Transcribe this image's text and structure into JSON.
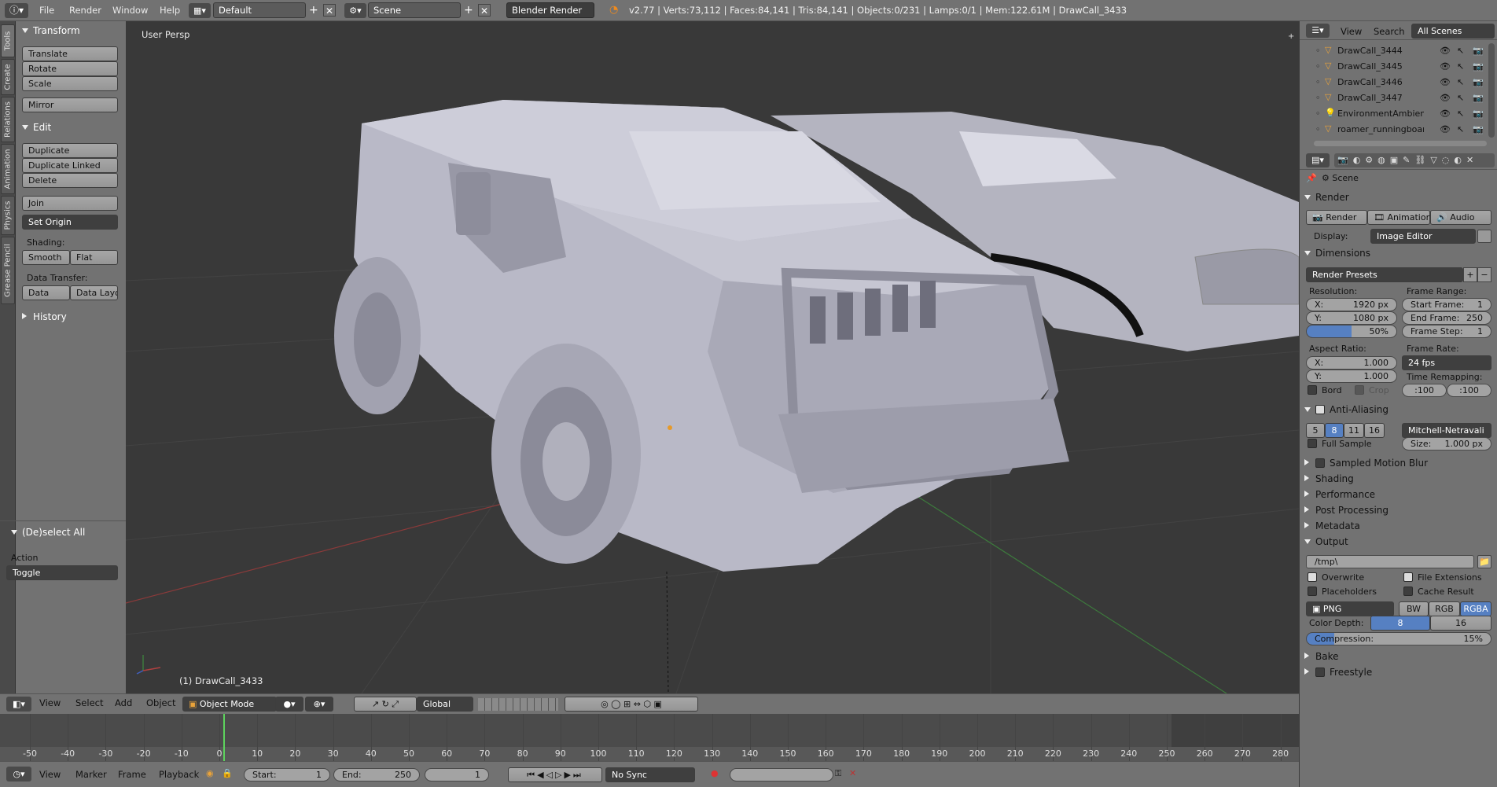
{
  "topbar": {
    "menus": [
      "File",
      "Render",
      "Window",
      "Help"
    ],
    "layout": "Default",
    "scene": "Scene",
    "engine": "Blender Render",
    "info": "v2.77 | Verts:73,112 | Faces:84,141 | Tris:84,141 | Objects:0/231 | Lamps:0/1 | Mem:122.61M | DrawCall_3433"
  },
  "sidetabs": [
    "Tools",
    "Create",
    "Relations",
    "Animation",
    "Physics",
    "Grease Pencil"
  ],
  "toolshelf": {
    "transform_title": "Transform",
    "transform": [
      "Translate",
      "Rotate",
      "Scale"
    ],
    "mirror": "Mirror",
    "edit_title": "Edit",
    "edit": [
      "Duplicate",
      "Duplicate Linked",
      "Delete"
    ],
    "join": "Join",
    "set_origin": "Set Origin",
    "shading_label": "Shading:",
    "smooth": "Smooth",
    "flat": "Flat",
    "data_transfer_label": "Data Transfer:",
    "data": "Data",
    "data_layo": "Data Layo",
    "history": "History",
    "op_title": "(De)select All",
    "action_label": "Action",
    "action_value": "Toggle"
  },
  "viewport": {
    "view_label": "User Persp",
    "object_label": "(1) DrawCall_3433"
  },
  "header3d": {
    "menus": [
      "View",
      "Select",
      "Add",
      "Object"
    ],
    "mode": "Object Mode",
    "orientation": "Global"
  },
  "timeline": {
    "ticks": [
      "-50",
      "-40",
      "-30",
      "-20",
      "-10",
      "0",
      "10",
      "20",
      "30",
      "40",
      "50",
      "60",
      "70",
      "80",
      "90",
      "100",
      "110",
      "120",
      "130",
      "140",
      "150",
      "160",
      "170",
      "180",
      "190",
      "200",
      "210",
      "220",
      "230",
      "240",
      "250",
      "260",
      "270",
      "280"
    ],
    "current_frame": 0,
    "menus": [
      "View",
      "Marker",
      "Frame",
      "Playback"
    ],
    "start_label": "Start:",
    "start": "1",
    "end_label": "End:",
    "end": "250",
    "frame": "1",
    "sync": "No Sync"
  },
  "outliner": {
    "menus": [
      "View",
      "Search"
    ],
    "filter": "All Scenes",
    "items": [
      "DrawCall_3444",
      "DrawCall_3445",
      "DrawCall_3446",
      "DrawCall_3447",
      "EnvironmentAmbientLi",
      "roamer_runningboard_F"
    ]
  },
  "properties": {
    "scene": "Scene",
    "render_title": "Render",
    "render_btn": "Render",
    "anim_btn": "Animation",
    "audio_btn": "Audio",
    "display_label": "Display:",
    "display_value": "Image Editor",
    "dimensions_title": "Dimensions",
    "presets": "Render Presets",
    "resolution_label": "Resolution:",
    "res_x": "X:",
    "res_x_val": "1920 px",
    "res_y": "Y:",
    "res_y_val": "1080 px",
    "res_pct": "50%",
    "frame_range_label": "Frame Range:",
    "start_frame": "Start Frame:",
    "start_frame_val": "1",
    "end_frame": "End Frame:",
    "end_frame_val": "250",
    "frame_step": "Frame Step:",
    "frame_step_val": "1",
    "aspect_label": "Aspect Ratio:",
    "asp_x": "X:",
    "asp_x_val": "1.000",
    "asp_y": "Y:",
    "asp_y_val": "1.000",
    "frame_rate_label": "Frame Rate:",
    "fps": "24 fps",
    "remap_label": "Time Remapping:",
    "remap_old": ":100",
    "remap_new": ":100",
    "bord": "Bord",
    "crop": "Crop",
    "aa_title": "Anti-Aliasing",
    "aa_samples": [
      "5",
      "8",
      "11",
      "16"
    ],
    "aa_filter": "Mitchell-Netravali",
    "full_sample": "Full Sample",
    "size_label": "Size:",
    "size_val": "1.000 px",
    "sections": [
      "Sampled Motion Blur",
      "Shading",
      "Performance",
      "Post Processing",
      "Metadata"
    ],
    "output_title": "Output",
    "output_path": "/tmp\\",
    "overwrite": "Overwrite",
    "file_ext": "File Extensions",
    "placeholders": "Placeholders",
    "cache": "Cache Result",
    "format": "PNG",
    "bw": "BW",
    "rgb": "RGB",
    "rgba": "RGBA",
    "depth_label": "Color Depth:",
    "depth8": "8",
    "depth16": "16",
    "compression_label": "Compression:",
    "compression_val": "15%",
    "bake": "Bake",
    "freestyle": "Freestyle"
  }
}
